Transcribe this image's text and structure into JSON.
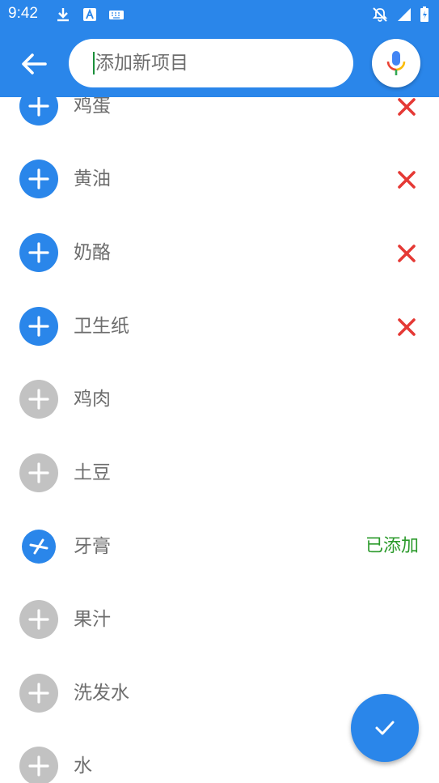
{
  "status_bar": {
    "time": "9:42"
  },
  "search": {
    "placeholder": "添加新项目",
    "value": ""
  },
  "items": [
    {
      "label": "鸡蛋",
      "state": "active"
    },
    {
      "label": "黄油",
      "state": "active"
    },
    {
      "label": "奶酪",
      "state": "active"
    },
    {
      "label": "卫生纸",
      "state": "active"
    },
    {
      "label": "鸡肉",
      "state": "inactive"
    },
    {
      "label": "土豆",
      "state": "inactive"
    },
    {
      "label": "牙膏",
      "state": "adding",
      "status": "已添加"
    },
    {
      "label": "果汁",
      "state": "inactive"
    },
    {
      "label": "洗发水",
      "state": "inactive"
    },
    {
      "label": "水",
      "state": "inactive"
    }
  ],
  "colors": {
    "primary": "#2a86ea",
    "inactive": "#c2c2c2",
    "remove": "#e53935",
    "added": "#2b9a2b"
  }
}
